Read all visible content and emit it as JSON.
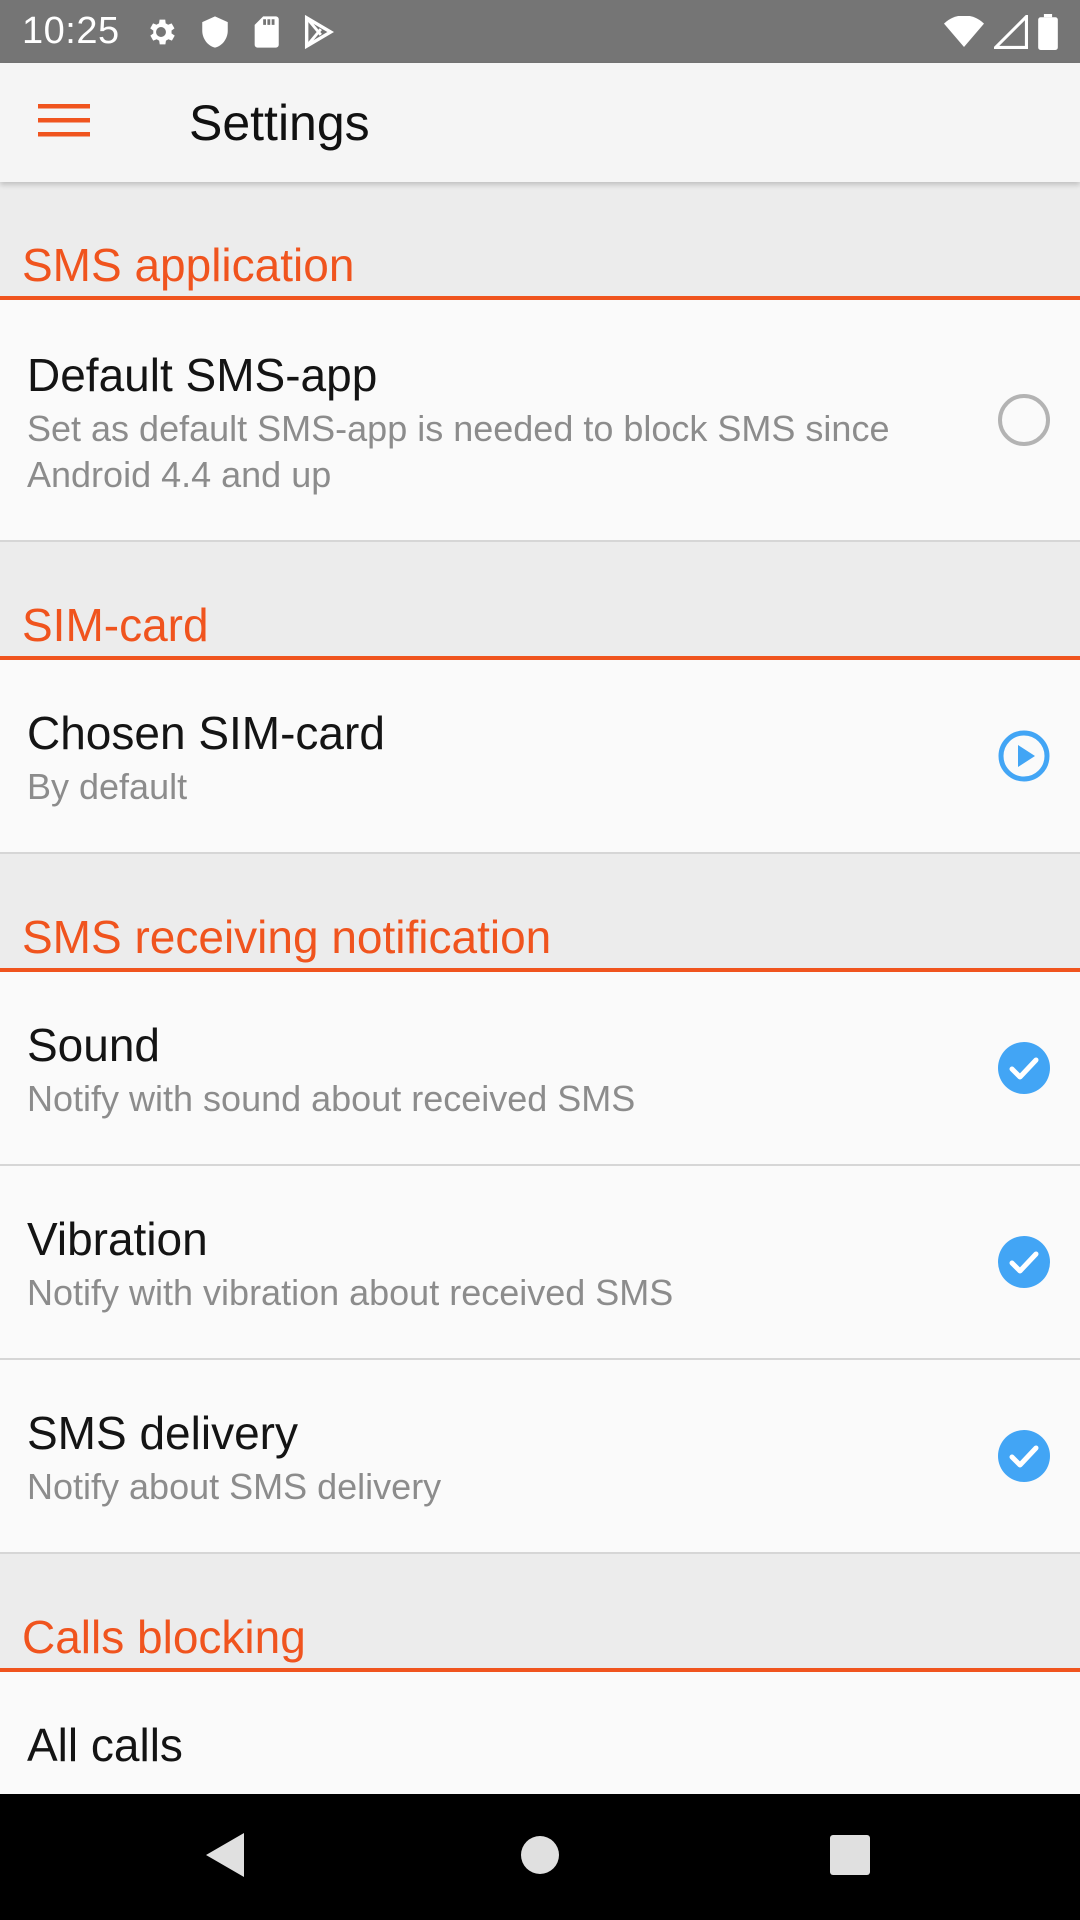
{
  "status_bar": {
    "time": "10:25",
    "left_icons": [
      "gear-icon",
      "shield-icon",
      "sd-card-icon",
      "play-store-icon"
    ],
    "right_icons": [
      "wifi-icon",
      "signal-icon",
      "battery-icon"
    ]
  },
  "app_bar": {
    "title": "Settings",
    "menu_icon": "hamburger-menu-icon"
  },
  "colors": {
    "accent": "#f0541e",
    "control_blue": "#42a5f5",
    "status_bar": "#757575"
  },
  "sections": [
    {
      "header": "SMS application",
      "items": [
        {
          "title": "Default SMS-app",
          "summary": "Set as default SMS-app is needed to block SMS since Android 4.4 and up",
          "control": "radio",
          "checked": false
        }
      ]
    },
    {
      "header": "SIM-card",
      "items": [
        {
          "title": "Chosen SIM-card",
          "summary": "By default",
          "control": "play-circle-icon"
        }
      ]
    },
    {
      "header": "SMS receiving notification",
      "items": [
        {
          "title": "Sound",
          "summary": "Notify with sound about received SMS",
          "control": "checkbox",
          "checked": true
        },
        {
          "title": "Vibration",
          "summary": "Notify with vibration about received SMS",
          "control": "checkbox",
          "checked": true
        },
        {
          "title": "SMS delivery",
          "summary": "Notify about SMS delivery",
          "control": "checkbox",
          "checked": true
        }
      ]
    },
    {
      "header": "Calls blocking",
      "items": [
        {
          "title": "All calls",
          "control": "radio",
          "checked": false
        }
      ]
    }
  ],
  "nav_bar": {
    "buttons": [
      "back-icon",
      "home-icon",
      "recents-icon"
    ]
  }
}
